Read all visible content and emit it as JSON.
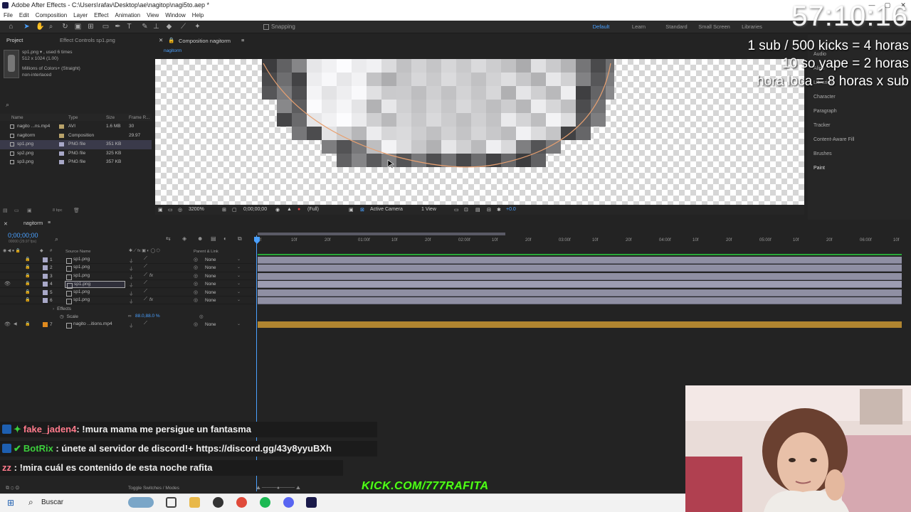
{
  "window": {
    "title": "Adobe After Effects - C:\\Users\\rafav\\Desktop\\ae\\nagitop\\nagi5to.aep *",
    "controls": [
      "—",
      "▢",
      "✕"
    ]
  },
  "menu": [
    "File",
    "Edit",
    "Composition",
    "Layer",
    "Effect",
    "Animation",
    "View",
    "Window",
    "Help"
  ],
  "toolbar": {
    "snapping_label": "Snapping",
    "workspaces": [
      "Default",
      "Learn",
      "Standard",
      "Small Screen",
      "Libraries"
    ],
    "active_workspace": "Default"
  },
  "project_panel": {
    "tab_project": "Project",
    "tab_effect_controls": "Effect Controls sp1.png",
    "selected_info": {
      "name": "sp1.png ▾ , used 6 times",
      "dims": "512 x 1024 (1.00)",
      "color": "Millions of Colors+ (Straight)",
      "scan": "non-interlaced"
    },
    "columns": [
      "Name",
      "Type",
      "Size",
      "Frame R..."
    ],
    "items": [
      {
        "name": "nagito ...ns.mp4",
        "type": "AVI",
        "size": "1.6 MB",
        "fps": "30",
        "label_color": "#b9a36a"
      },
      {
        "name": "nagitorm",
        "type": "Composition",
        "size": "",
        "fps": "29.97",
        "label_color": "#b9a36a"
      },
      {
        "name": "sp1.png",
        "type": "PNG file",
        "size": "351 KB",
        "fps": "",
        "label_color": "#a8a8c8",
        "selected": true
      },
      {
        "name": "sp2.png",
        "type": "PNG file",
        "size": "325 KB",
        "fps": "",
        "label_color": "#a8a8c8"
      },
      {
        "name": "sp3.png",
        "type": "PNG file",
        "size": "357 KB",
        "fps": "",
        "label_color": "#a8a8c8"
      }
    ],
    "bpc": "8 bpc"
  },
  "composition": {
    "tab_label": "Composition nagitorm",
    "sub_tab": "nagitorm",
    "zoom": "3200%",
    "timecode": "0;00;00;00",
    "resolution": "(Full)",
    "camera": "Active Camera",
    "views": "1 View",
    "exposure": "+0.0"
  },
  "right_panels": [
    "Audio",
    "Align",
    "Libraries",
    "Character",
    "Paragraph",
    "Tracker",
    "Content-Aware Fill",
    "Brushes",
    "Paint"
  ],
  "stream_overlay": {
    "clock": "57:10:16",
    "lines": [
      "1 sub / 500 kicks = 4 horas",
      "10 so yape = 2 horas",
      "hora loca = 8 horas x sub"
    ]
  },
  "timeline": {
    "tab_label": "nagitorm",
    "timecode": "0;00;00;00",
    "timecode_sub": "00000 (29.97 fps)",
    "columns": {
      "source": "Source Name",
      "parent": "Parent & Link"
    },
    "ruler_ticks": [
      "0f",
      "10f",
      "20f",
      "01:00f",
      "10f",
      "20f",
      "02:00f",
      "10f",
      "20f",
      "03:00f",
      "10f",
      "20f",
      "04:00f",
      "10f",
      "20f",
      "05:00f",
      "10f",
      "20f",
      "06:00f",
      "10f"
    ],
    "layers": [
      {
        "num": "1",
        "name": "sp1.png",
        "parent": "None",
        "fx": ""
      },
      {
        "num": "2",
        "name": "sp1.png",
        "parent": "None",
        "fx": ""
      },
      {
        "num": "3",
        "name": "sp1.png",
        "parent": "None",
        "fx": "fx"
      },
      {
        "num": "4",
        "name": "sp1.png",
        "parent": "None",
        "fx": "",
        "selected": true
      },
      {
        "num": "5",
        "name": "sp1.png",
        "parent": "None",
        "fx": ""
      },
      {
        "num": "6",
        "name": "sp1.png",
        "parent": "None",
        "fx": "fx"
      }
    ],
    "effects_label": "Effects",
    "scale_label": "Scale",
    "scale_value": "88.0,88.0 %",
    "layer7": {
      "num": "7",
      "name": "nagito ...itions.mp4",
      "parent": "None"
    },
    "toggle_label": "Toggle Switches / Modes"
  },
  "chat": [
    {
      "user": "fake_jaden4",
      "sep": ": ",
      "msg": "!mura mama me persigue un fantasma"
    },
    {
      "user": "BotRix",
      "sep": " : ",
      "msg": "únete al servidor de discord!+ https://discord.gg/43y8yyuBXh"
    },
    {
      "user": "zz",
      "sep": " : ",
      "msg": "!mira cuál es contenido de esta noche rafita"
    }
  ],
  "kick_banner": "KICK.COM/777RAFITA",
  "taskbar": {
    "search_label": "Buscar"
  }
}
